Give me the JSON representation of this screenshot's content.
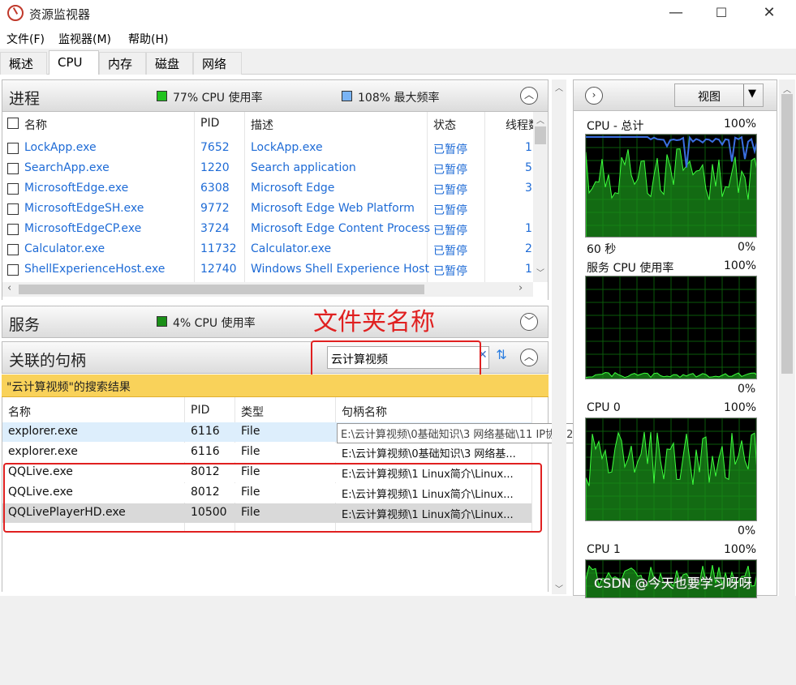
{
  "window": {
    "title": "资源监视器",
    "minimize": "—",
    "maximize": "☐",
    "close": "✕"
  },
  "menu": [
    "文件(F)",
    "监视器(M)",
    "帮助(H)"
  ],
  "tabs": [
    "概述",
    "CPU",
    "内存",
    "磁盘",
    "网络"
  ],
  "active_tab": "CPU",
  "processes": {
    "title": "进程",
    "cpu_usage": "77% CPU 使用率",
    "max_freq": "108% 最大频率",
    "columns": [
      "名称",
      "PID",
      "描述",
      "状态",
      "线程数"
    ],
    "rows": [
      {
        "name": "LockApp.exe",
        "pid": "7652",
        "desc": "LockApp.exe",
        "status": "已暂停",
        "threads": "1"
      },
      {
        "name": "SearchApp.exe",
        "pid": "1220",
        "desc": "Search application",
        "status": "已暂停",
        "threads": "5"
      },
      {
        "name": "MicrosoftEdge.exe",
        "pid": "6308",
        "desc": "Microsoft Edge",
        "status": "已暂停",
        "threads": "3"
      },
      {
        "name": "MicrosoftEdgeSH.exe",
        "pid": "9772",
        "desc": "Microsoft Edge Web Platform",
        "status": "已暂停",
        "threads": ""
      },
      {
        "name": "MicrosoftEdgeCP.exe",
        "pid": "3724",
        "desc": "Microsoft Edge Content Process",
        "status": "已暂停",
        "threads": "1"
      },
      {
        "name": "Calculator.exe",
        "pid": "11732",
        "desc": "Calculator.exe",
        "status": "已暂停",
        "threads": "2"
      },
      {
        "name": "ShellExperienceHost.exe",
        "pid": "12740",
        "desc": "Windows Shell Experience Host",
        "status": "已暂停",
        "threads": "1"
      }
    ]
  },
  "services": {
    "title": "服务",
    "cpu_usage": "4% CPU 使用率"
  },
  "handles": {
    "title": "关联的句柄",
    "search_value": "云计算视频",
    "results_label": "\"云计算视频\"的搜索结果",
    "columns": [
      "名称",
      "PID",
      "类型",
      "句柄名称"
    ],
    "rows": [
      {
        "name": "explorer.exe",
        "pid": "6116",
        "type": "File",
        "handle": "E:\\云计算视频\\0基础知识\\3 网络基础\\11 IP协议2"
      },
      {
        "name": "explorer.exe",
        "pid": "6116",
        "type": "File",
        "handle": "E:\\云计算视频\\0基础知识\\3 网络基..."
      },
      {
        "name": "QQLive.exe",
        "pid": "8012",
        "type": "File",
        "handle": "E:\\云计算视频\\1 Linux简介\\Linux..."
      },
      {
        "name": "QQLive.exe",
        "pid": "8012",
        "type": "File",
        "handle": "E:\\云计算视频\\1 Linux简介\\Linux..."
      },
      {
        "name": "QQLivePlayerHD.exe",
        "pid": "10500",
        "type": "File",
        "handle": "E:\\云计算视频\\1 Linux简介\\Linux..."
      }
    ]
  },
  "annotation": "文件夹名称",
  "right_panel": {
    "view_label": "视图",
    "graphs": [
      {
        "title": "CPU - 总计",
        "max": "100%",
        "bottom_left": "60 秒",
        "min": "0%"
      },
      {
        "title": "服务 CPU 使用率",
        "max": "100%",
        "bottom_left": "",
        "min": "0%"
      },
      {
        "title": "CPU 0",
        "max": "100%",
        "bottom_left": "",
        "min": "0%"
      },
      {
        "title": "CPU 1",
        "max": "100%",
        "bottom_left": "",
        "min": ""
      }
    ]
  },
  "watermark": "CSDN @今天也要学习呀呀",
  "colors": {
    "legend_green": "#22c31f",
    "legend_blue": "#7ab4f5",
    "annotation_red": "#e02020",
    "link_blue": "#1e6bd6",
    "result_bar": "#f9d25a"
  }
}
